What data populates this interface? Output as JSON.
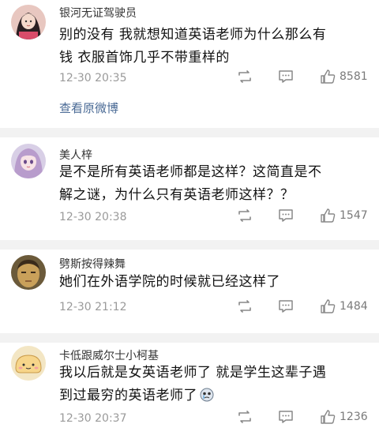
{
  "comments": [
    {
      "username": "银河无证驾驶员",
      "line1": "别的没有 我就想知道英语老师为什么那么有",
      "line2": "钱 衣服首饰几乎不带重样的",
      "time": "12-30 20:35",
      "likes": "8581",
      "extra_link": "查看原微博",
      "avatar_icon": "avatar-girl-icon"
    },
    {
      "username": "美人梓",
      "line1": "是不是所有英语老师都是这样？这简直是不",
      "line2": "解之谜，为什么只有英语老师这样？？",
      "time": "12-30 20:38",
      "likes": "1547",
      "avatar_icon": "avatar-anime-girl-icon"
    },
    {
      "username": "劈斯按得辣舞",
      "line1": "她们在外语学院的时候就已经这样了",
      "time": "12-30 21:12",
      "likes": "1484",
      "avatar_icon": "avatar-face-icon"
    },
    {
      "username": "卡低跟威尔士小柯基",
      "line1": "我以后就是女英语老师了 就是学生这辈子遇",
      "line2": "到过最穷的英语老师了",
      "time": "12-30 20:37",
      "likes": "1236",
      "avatar_icon": "avatar-cartoon-bread-icon"
    }
  ],
  "colors": {
    "link": "#4a6a95",
    "divider": "#f2f2f2",
    "meta": "#9a9a9a"
  }
}
